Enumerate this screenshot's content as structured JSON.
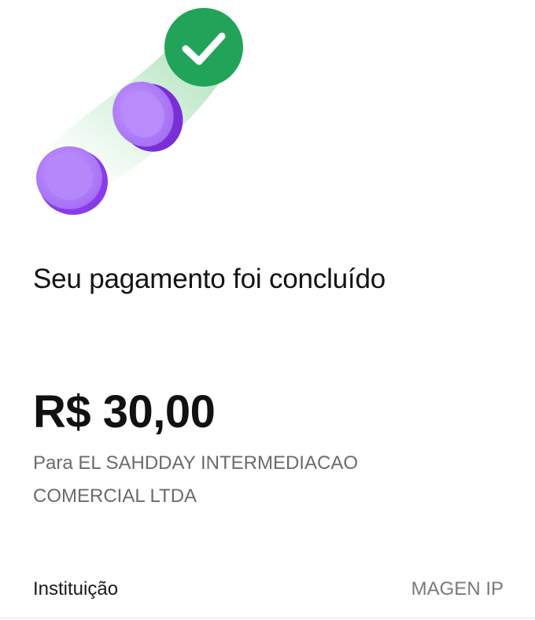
{
  "header": {
    "illustration_icons": [
      "check-icon",
      "coin-icon",
      "coin-icon"
    ],
    "colors": {
      "success_green": "#22a35a",
      "coin_purple": "#8a3be8",
      "trail_green": "#c9ecd3"
    }
  },
  "main": {
    "title": "Seu pagamento foi concluído",
    "amount": "R$ 30,00",
    "recipient": "Para EL SAHDDAY INTERMEDIACAO COMERCIAL LTDA"
  },
  "details": [
    {
      "label": "Instituição",
      "value": "MAGEN IP"
    }
  ]
}
